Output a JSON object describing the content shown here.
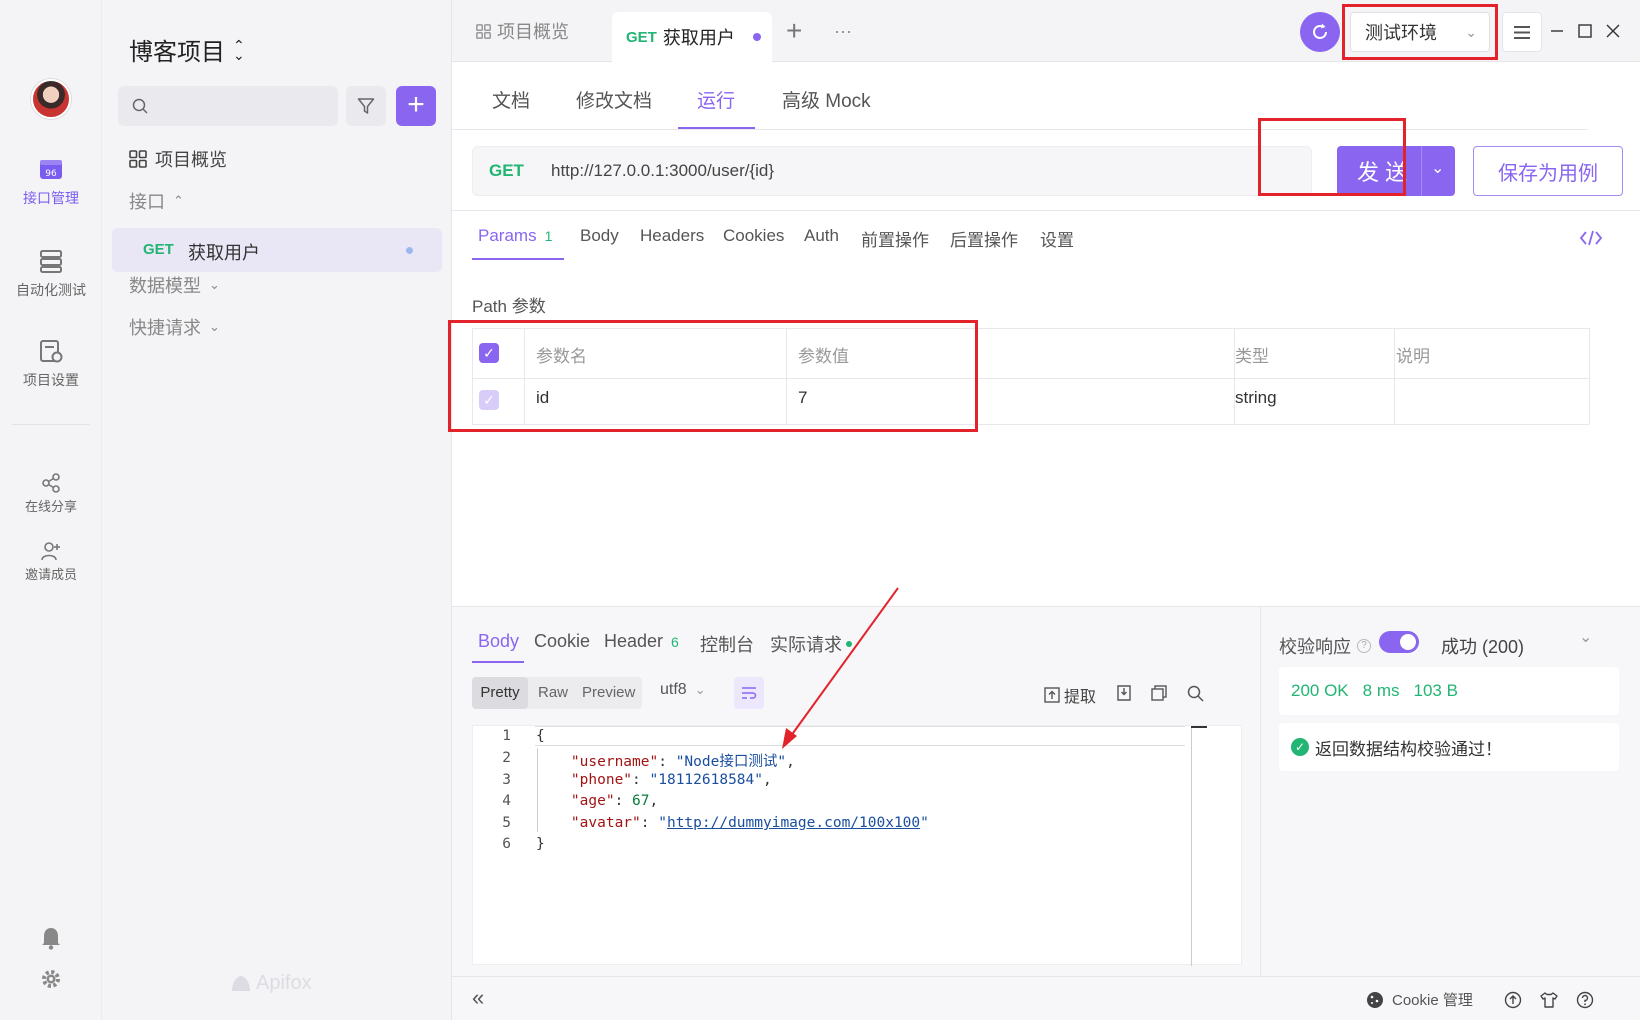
{
  "rail": {
    "items": [
      {
        "label": "接口管理",
        "icon": "api-manage-icon"
      },
      {
        "label": "自动化测试",
        "icon": "auto-test-icon"
      },
      {
        "label": "项目设置",
        "icon": "project-settings-icon"
      },
      {
        "label": "在线分享",
        "icon": "share-icon"
      },
      {
        "label": "邀请成员",
        "icon": "invite-member-icon"
      }
    ]
  },
  "sidebar": {
    "project_title": "博客项目",
    "overview": "项目概览",
    "interface_group": "接口",
    "active_item": {
      "method": "GET",
      "name": "获取用户"
    },
    "data_model": "数据模型",
    "quick_request": "快捷请求",
    "brand": "Apifox"
  },
  "topbar": {
    "tab_overview": "项目概览",
    "tab_active_method": "GET",
    "tab_active_name": "获取用户",
    "plus": "+",
    "more": "···",
    "environment": "测试环境"
  },
  "subtabs": [
    "文档",
    "修改文档",
    "运行",
    "高级 Mock"
  ],
  "request": {
    "method": "GET",
    "url": "http://127.0.0.1:3000/user/{id}",
    "send_label": "发 送",
    "save_case_label": "保存为用例"
  },
  "param_tabs": {
    "params": "Params",
    "params_count": "1",
    "others": [
      "Body",
      "Headers",
      "Cookies",
      "Auth",
      "前置操作",
      "后置操作",
      "设置"
    ]
  },
  "path_params": {
    "title": "Path 参数",
    "headers": [
      "参数名",
      "参数值",
      "类型",
      "说明"
    ],
    "rows": [
      {
        "name": "id",
        "value": "7",
        "type": "string",
        "desc": ""
      }
    ]
  },
  "response": {
    "tabs": {
      "body": "Body",
      "cookie": "Cookie",
      "header": "Header",
      "header_count": "6",
      "console": "控制台",
      "actual": "实际请求"
    },
    "formats": [
      "Pretty",
      "Raw",
      "Preview"
    ],
    "encoding": "utf8",
    "extract": "提取",
    "code": {
      "open": "{",
      "username_key": "\"username\"",
      "username_val": "\"Node接口测试\"",
      "phone_key": "\"phone\"",
      "phone_val": "\"18112618584\"",
      "age_key": "\"age\"",
      "age_val": "67",
      "avatar_key": "\"avatar\"",
      "avatar_val": "http://dummyimage.com/100x100",
      "close": "}"
    },
    "line_numbers": [
      "1",
      "2",
      "3",
      "4",
      "5",
      "6"
    ]
  },
  "validation": {
    "label": "校验响应",
    "result": "成功 (200)",
    "status": "200 OK",
    "time": "8 ms",
    "size": "103 B",
    "message": "返回数据结构校验通过！"
  },
  "statusbar": {
    "collapse": "«",
    "cookie_manage": "Cookie 管理"
  }
}
